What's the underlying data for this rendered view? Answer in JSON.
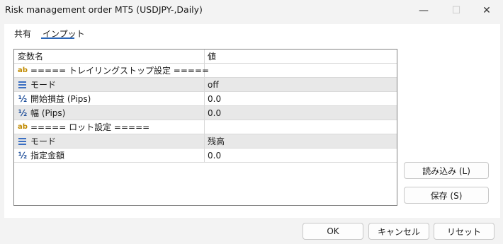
{
  "window": {
    "title": "Risk management order MT5 (USDJPY-,Daily)",
    "minimize_glyph": "—",
    "maximize_glyph": "☐",
    "close_glyph": "✕"
  },
  "tabs": [
    {
      "label": "共有",
      "selected": false
    },
    {
      "label": "インプット",
      "selected": true
    }
  ],
  "grid": {
    "headers": {
      "name": "変数名",
      "value": "値"
    },
    "rows": [
      {
        "icon": "ab-icon",
        "icon_text": "ab",
        "name": "===== トレイリングストップ設定 =====",
        "value": ""
      },
      {
        "icon": "enum-icon",
        "name": "モード",
        "value": "off"
      },
      {
        "icon": "half-icon",
        "icon_text": "½",
        "name": "開始損益 (Pips)",
        "value": "0.0"
      },
      {
        "icon": "half-icon",
        "icon_text": "½",
        "name": "幅 (Pips)",
        "value": "0.0"
      },
      {
        "icon": "ab-icon",
        "icon_text": "ab",
        "name": "===== ロット設定 =====",
        "value": ""
      },
      {
        "icon": "enum-icon",
        "name": "モード",
        "value": "残高"
      },
      {
        "icon": "half-icon",
        "icon_text": "½",
        "name": "指定金額",
        "value": "0.0"
      }
    ]
  },
  "side_buttons": {
    "load": "読み込み (L)",
    "save": "保存 (S)"
  },
  "bottom_buttons": {
    "ok": "OK",
    "cancel": "キャンセル",
    "reset": "リセット"
  },
  "colors": {
    "accent": "#2a66b8",
    "alt_row": "#e8e8e8",
    "string_icon": "#c08a00",
    "number_icon": "#1f4f9a"
  }
}
